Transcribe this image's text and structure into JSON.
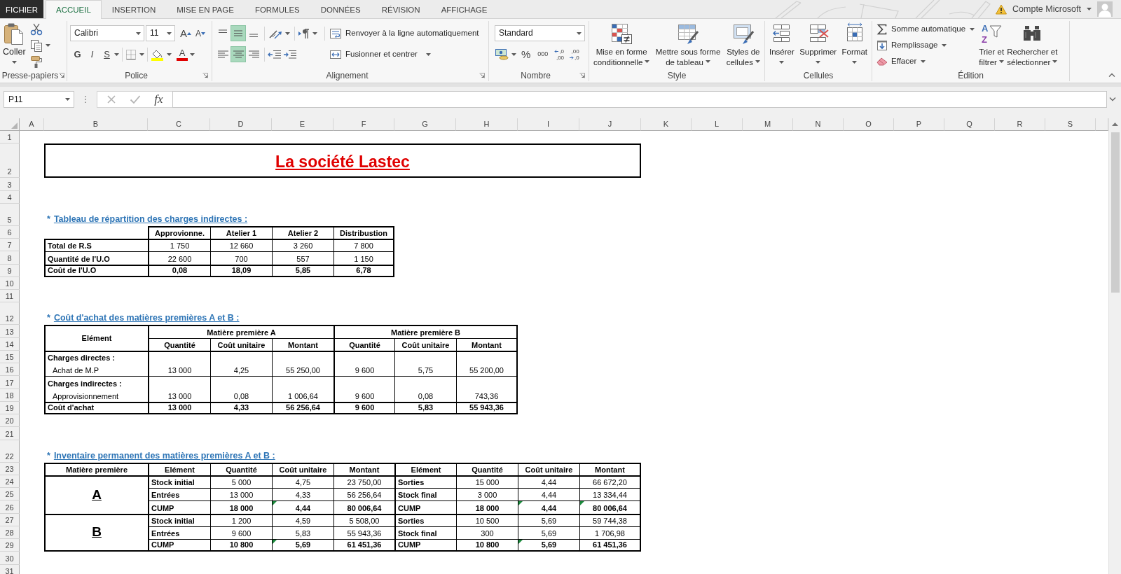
{
  "ribbon": {
    "tabs": [
      {
        "label": "FICHIER",
        "kind": "file",
        "selected": false
      },
      {
        "label": "ACCUEIL",
        "kind": "tab",
        "selected": true
      },
      {
        "label": "INSERTION",
        "kind": "tab",
        "selected": false
      },
      {
        "label": "MISE EN PAGE",
        "kind": "tab",
        "selected": false
      },
      {
        "label": "FORMULES",
        "kind": "tab",
        "selected": false
      },
      {
        "label": "DONNÉES",
        "kind": "tab",
        "selected": false
      },
      {
        "label": "RÉVISION",
        "kind": "tab",
        "selected": false
      },
      {
        "label": "AFFICHAGE",
        "kind": "tab",
        "selected": false
      }
    ],
    "account": "Compte Microsoft",
    "clipboard": {
      "label": "Presse-papiers",
      "paste": "Coller"
    },
    "font": {
      "label": "Police",
      "name": "Calibri",
      "size": "11",
      "grow": "A",
      "shrink": "A",
      "styles": [
        {
          "label": "G",
          "kind": "bold"
        },
        {
          "label": "I",
          "kind": "italic"
        },
        {
          "label": "S",
          "kind": "underline"
        }
      ],
      "color_letter": "A"
    },
    "alignment": {
      "label": "Alignement",
      "vertical": [
        {
          "kind": "top",
          "selected": false
        },
        {
          "kind": "middle",
          "selected": true
        },
        {
          "kind": "bottom",
          "selected": false
        }
      ],
      "horizontal": [
        {
          "kind": "left",
          "selected": false
        },
        {
          "kind": "center",
          "selected": true
        },
        {
          "kind": "right",
          "selected": false
        }
      ],
      "wrap": "Renvoyer à la ligne automatiquement",
      "merge": "Fusionner et centrer"
    },
    "number": {
      "label": "Nombre",
      "format": "Standard",
      "percent": "%",
      "thousands": "000",
      "decimals": [
        {
          "kind": "increase",
          "top": ",0",
          "bottom": ",00"
        },
        {
          "kind": "decrease",
          "top": ",00",
          "bottom": ",0"
        }
      ]
    },
    "style": {
      "label": "Style",
      "buttons": [
        {
          "kind": "conditional",
          "lines": [
            "Mise en forme",
            "conditionnelle"
          ]
        },
        {
          "kind": "table",
          "lines": [
            "Mettre sous forme",
            "de tableau"
          ]
        },
        {
          "kind": "cell_styles",
          "lines": [
            "Styles de",
            "cellules"
          ]
        }
      ]
    },
    "cells": {
      "label": "Cellules",
      "buttons": [
        {
          "kind": "insert",
          "label": "Insérer"
        },
        {
          "kind": "delete",
          "label": "Supprimer"
        },
        {
          "kind": "format",
          "label": "Format"
        }
      ]
    },
    "editing": {
      "label": "Édition",
      "items": [
        {
          "kind": "sum",
          "label": "Somme automatique"
        },
        {
          "kind": "fill",
          "label": "Remplissage"
        },
        {
          "kind": "clear",
          "label": "Effacer"
        }
      ],
      "buttons": [
        {
          "kind": "sort",
          "lines": [
            "Trier et",
            "filtrer"
          ],
          "glyphs": [
            "A",
            "Z"
          ]
        },
        {
          "kind": "find",
          "lines": [
            "Rechercher et",
            "sélectionner"
          ]
        }
      ]
    }
  },
  "formula_bar": {
    "name_box": "P11",
    "grip": "⋮",
    "buttons": [
      {
        "kind": "cancel",
        "disabled": true
      },
      {
        "kind": "enter",
        "disabled": true
      },
      {
        "kind": "function",
        "label": "fx",
        "disabled": false
      }
    ]
  },
  "sheet": {
    "column_headers": [
      "A",
      "B",
      "C",
      "D",
      "E",
      "F",
      "G",
      "H",
      "I",
      "J",
      "K",
      "L",
      "M",
      "N",
      "O",
      "P",
      "Q",
      "R",
      "S"
    ],
    "row_headers": [
      "1",
      "2",
      "3",
      "4",
      "5",
      "6",
      "7",
      "8",
      "9",
      "10",
      "11",
      "12",
      "13",
      "14",
      "15",
      "16",
      "17",
      "18",
      "19",
      "20",
      "21",
      "22",
      "23",
      "24",
      "25",
      "26",
      "27",
      "28",
      "29",
      "30",
      "31"
    ],
    "title": "La société Lastec",
    "sections": [
      {
        "kind": "allocation",
        "bullet": "*",
        "heading": "Tableau de répartition des charges indirectes :",
        "table": {
          "columns": [
            "Approvionne.",
            "Atelier 1",
            "Atelier 2",
            "Distribustion"
          ],
          "rows": [
            {
              "kind": "data",
              "label": "Total de R.S",
              "values": [
                "1 750",
                "12 660",
                "3 260",
                "7 800"
              ]
            },
            {
              "kind": "data",
              "label": "Quantité de l'U.O",
              "values": [
                "22 600",
                "700",
                "557",
                "1 150"
              ]
            },
            {
              "kind": "total",
              "label": "Coût de l'U.O",
              "values": [
                "0,08",
                "18,09",
                "5,85",
                "6,78"
              ]
            }
          ]
        }
      },
      {
        "kind": "purchase_cost",
        "bullet": "*",
        "heading": "Coût d'achat des matières premières A et B :",
        "table": {
          "corner": "Elément",
          "groups": [
            "Matière première A",
            "Matière première B"
          ],
          "columns": [
            "Quantité",
            "Coût unitaire",
            "Montant",
            "Quantité",
            "Coût unitaire",
            "Montant"
          ],
          "rows": [
            {
              "kind": "category",
              "label": "Charges directes :"
            },
            {
              "kind": "item",
              "label": "Achat de M.P",
              "values": [
                "13 000",
                "4,25",
                "55 250,00",
                "9 600",
                "5,75",
                "55 200,00"
              ]
            },
            {
              "kind": "category",
              "label": "Charges indirectes :"
            },
            {
              "kind": "item",
              "label": "Approvisionnement",
              "values": [
                "13 000",
                "0,08",
                "1 006,64",
                "9 600",
                "0,08",
                "743,36"
              ]
            },
            {
              "kind": "total",
              "label": "Coût d'achat",
              "values": [
                "13 000",
                "4,33",
                "56 256,64",
                "9 600",
                "5,83",
                "55 943,36"
              ]
            }
          ]
        }
      },
      {
        "kind": "inventory",
        "bullet": "*",
        "heading": "Inventaire permanent des matières premières A et B :",
        "table": {
          "columns": [
            "Matière première",
            "Elément",
            "Quantité",
            "Coût unitaire",
            "Montant",
            "Elément",
            "Quantité",
            "Coût unitaire",
            "Montant"
          ],
          "groups": [
            {
              "name": "A",
              "rows": [
                {
                  "kind": "entry",
                  "labels": [
                    "Stock initial",
                    "Sorties"
                  ],
                  "cells": [
                    {
                      "text": "5 000",
                      "flagged": false
                    },
                    {
                      "text": "4,75",
                      "flagged": false
                    },
                    {
                      "text": "23 750,00",
                      "flagged": false
                    },
                    {
                      "text": "15 000",
                      "flagged": false
                    },
                    {
                      "text": "4,44",
                      "flagged": false
                    },
                    {
                      "text": "66 672,20",
                      "flagged": false
                    }
                  ]
                },
                {
                  "kind": "entry",
                  "labels": [
                    "Entrées",
                    "Stock final"
                  ],
                  "cells": [
                    {
                      "text": "13 000",
                      "flagged": false
                    },
                    {
                      "text": "4,33",
                      "flagged": false
                    },
                    {
                      "text": "56 256,64",
                      "flagged": false
                    },
                    {
                      "text": "3 000",
                      "flagged": false
                    },
                    {
                      "text": "4,44",
                      "flagged": false
                    },
                    {
                      "text": "13 334,44",
                      "flagged": false
                    }
                  ]
                },
                {
                  "kind": "total",
                  "labels": [
                    "CUMP",
                    "CUMP"
                  ],
                  "cells": [
                    {
                      "text": "18 000",
                      "flagged": false
                    },
                    {
                      "text": "4,44",
                      "flagged": true
                    },
                    {
                      "text": "80 006,64",
                      "flagged": false
                    },
                    {
                      "text": "18 000",
                      "flagged": false
                    },
                    {
                      "text": "4,44",
                      "flagged": true
                    },
                    {
                      "text": "80 006,64",
                      "flagged": true
                    }
                  ]
                }
              ]
            },
            {
              "name": "B",
              "rows": [
                {
                  "kind": "entry",
                  "labels": [
                    "Stock initial",
                    "Sorties"
                  ],
                  "cells": [
                    {
                      "text": "1 200",
                      "flagged": false
                    },
                    {
                      "text": "4,59",
                      "flagged": false
                    },
                    {
                      "text": "5 508,00",
                      "flagged": false
                    },
                    {
                      "text": "10 500",
                      "flagged": false
                    },
                    {
                      "text": "5,69",
                      "flagged": false
                    },
                    {
                      "text": "59 744,38",
                      "flagged": false
                    }
                  ]
                },
                {
                  "kind": "entry",
                  "labels": [
                    "Entrées",
                    "Stock final"
                  ],
                  "cells": [
                    {
                      "text": "9 600",
                      "flagged": false
                    },
                    {
                      "text": "5,83",
                      "flagged": false
                    },
                    {
                      "text": "55 943,36",
                      "flagged": false
                    },
                    {
                      "text": "300",
                      "flagged": false
                    },
                    {
                      "text": "5,69",
                      "flagged": false
                    },
                    {
                      "text": "1 706,98",
                      "flagged": false
                    }
                  ]
                },
                {
                  "kind": "total",
                  "labels": [
                    "CUMP",
                    "CUMP"
                  ],
                  "cells": [
                    {
                      "text": "10 800",
                      "flagged": false
                    },
                    {
                      "text": "5,69",
                      "flagged": true
                    },
                    {
                      "text": "61 451,36",
                      "flagged": false
                    },
                    {
                      "text": "10 800",
                      "flagged": false
                    },
                    {
                      "text": "5,69",
                      "flagged": true
                    },
                    {
                      "text": "61 451,36",
                      "flagged": false
                    }
                  ]
                }
              ]
            }
          ]
        }
      }
    ]
  }
}
